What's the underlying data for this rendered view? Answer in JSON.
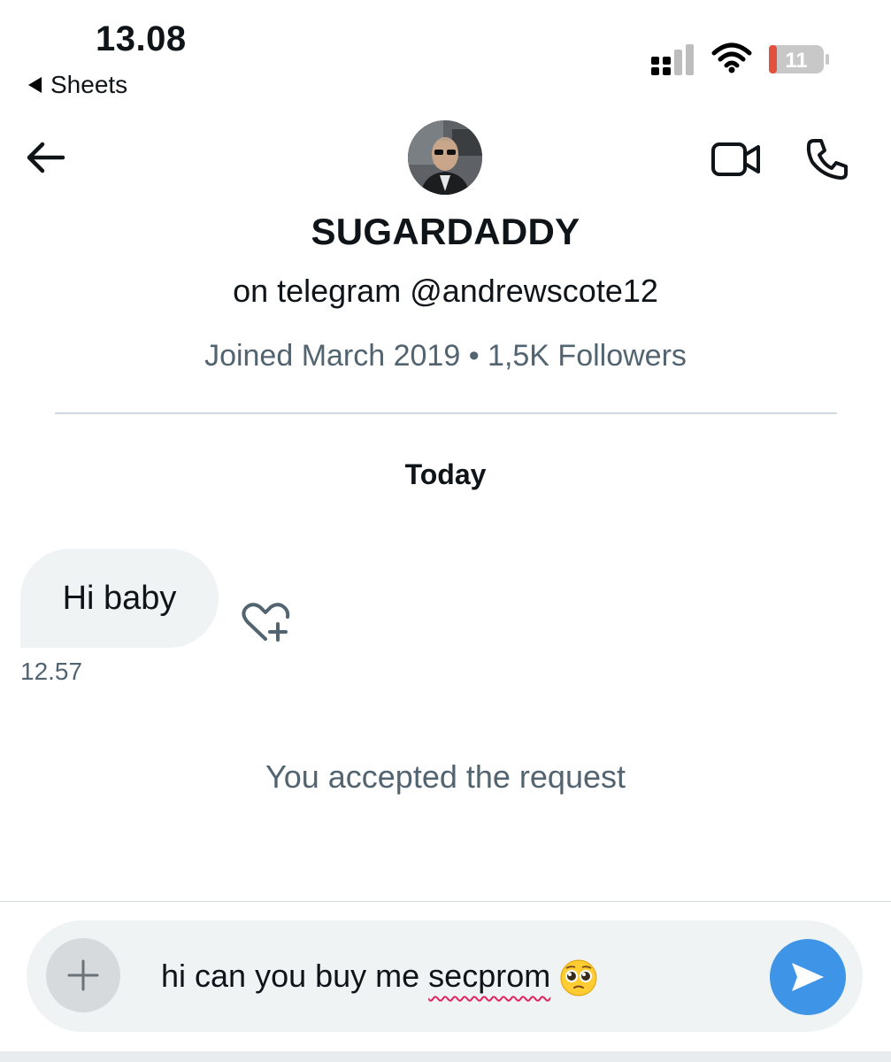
{
  "status_bar": {
    "time": "13.08",
    "back_app_label": "Sheets",
    "battery_level": "11",
    "battery_color": "#e0523e"
  },
  "header": {
    "name": "SUGARDADDY",
    "bio": "on telegram @andrewscote12",
    "meta": "Joined March 2019 • 1,5K Followers",
    "icons": [
      "back-arrow-icon",
      "video-call-icon",
      "phone-call-icon"
    ]
  },
  "conversation": {
    "day_label": "Today",
    "messages": [
      {
        "text": "Hi baby",
        "time": "12.57",
        "direction": "incoming"
      }
    ],
    "system_note": "You accepted the request"
  },
  "composer": {
    "text_before": "hi can you buy me ",
    "misspelled_word": "secprom",
    "emoji": "pleading-face",
    "send_color": "#3e94e6"
  }
}
